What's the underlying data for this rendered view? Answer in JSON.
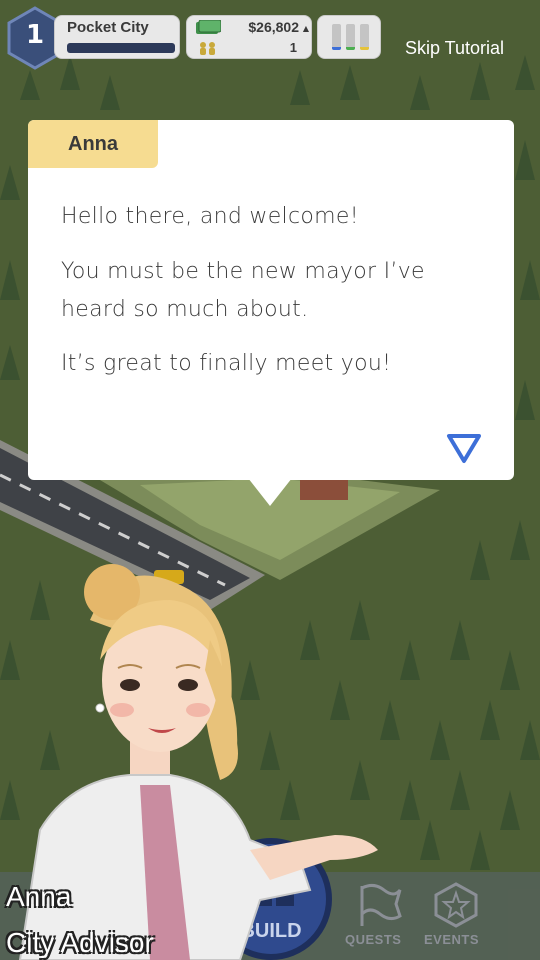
{
  "hud": {
    "level": "1",
    "city_name": "Pocket City",
    "money": "$26,802",
    "population": "1",
    "skip_label": "Skip Tutorial"
  },
  "dialog": {
    "speaker": "Anna",
    "line1": "Hello there, and welcome!",
    "line2": "You must be the new mayor I’ve heard so much about.",
    "line3": "It’s great to finally meet you!"
  },
  "character": {
    "name": "Anna",
    "role": "City Advisor"
  },
  "nav": {
    "build_label": "BUILD",
    "quests_label": "QUESTS",
    "events_label": "EVENTS"
  },
  "colors": {
    "grass": "#4d5e35",
    "dialog_tab": "#f6dc91",
    "build_button": "#2f4a8e",
    "arrow": "#3d6fd8"
  },
  "icons": [
    "level-hex-icon",
    "money-icon",
    "population-icon",
    "stats-bars-icon",
    "next-triangle-icon",
    "build-icon",
    "quests-flag-icon",
    "events-star-icon"
  ]
}
